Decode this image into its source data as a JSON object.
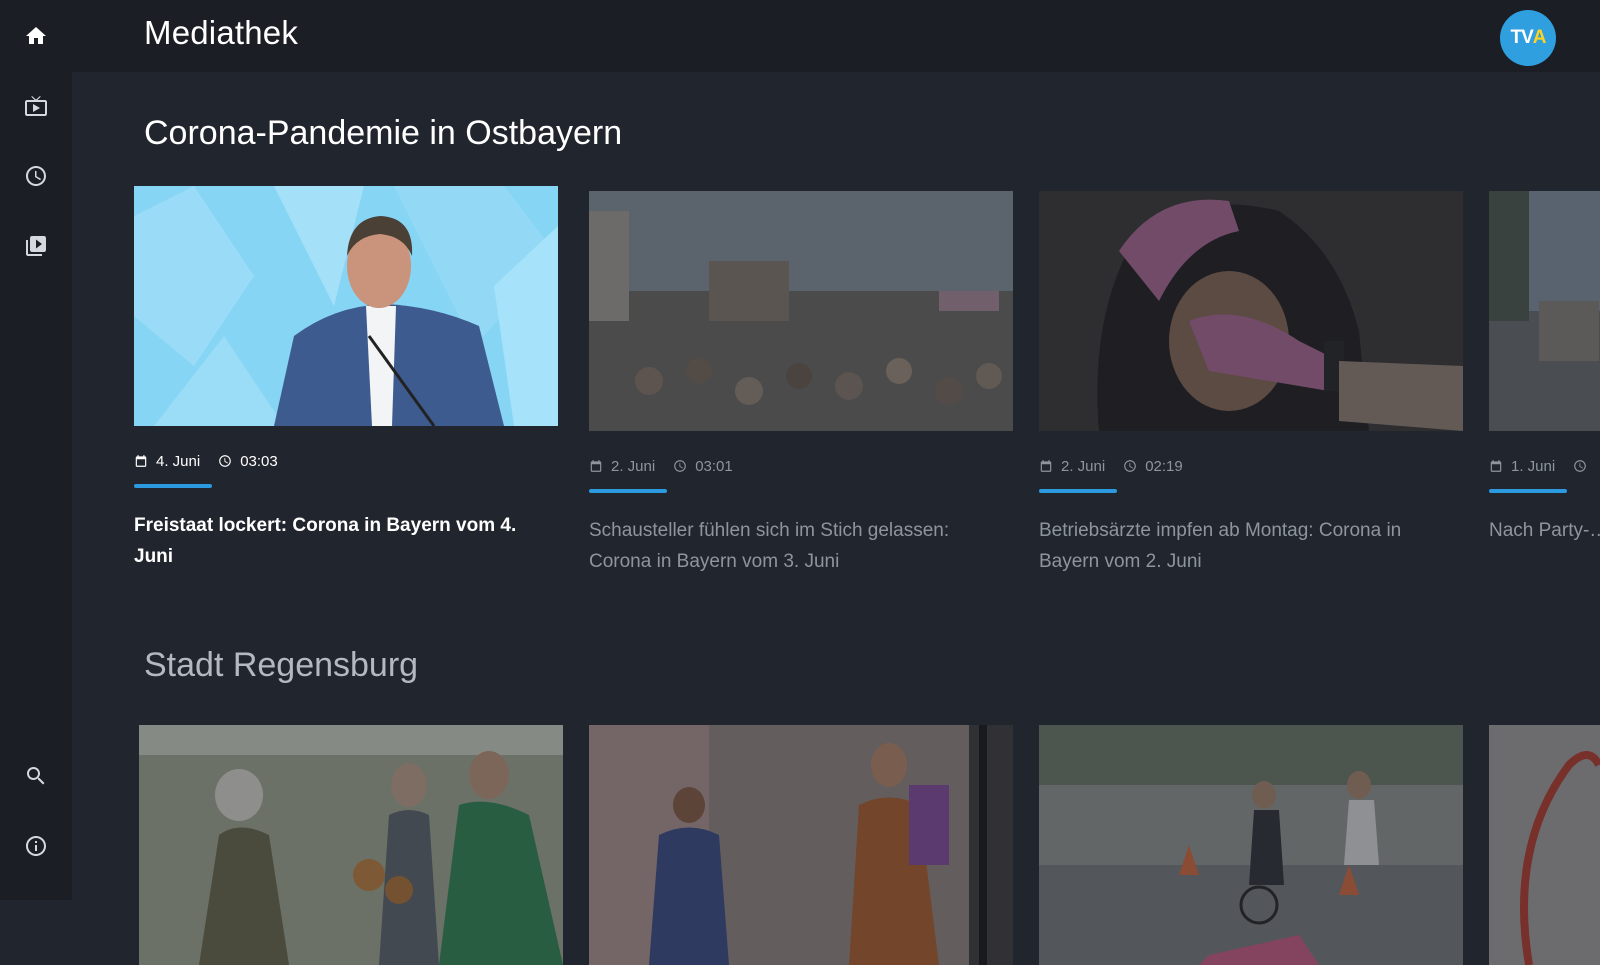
{
  "header": {
    "title": "Mediathek",
    "logo": {
      "text_main": "TV",
      "text_accent": "A"
    }
  },
  "sidebar": {
    "items": [
      {
        "name": "home",
        "icon": "home-icon"
      },
      {
        "name": "live-tv",
        "icon": "tv-icon"
      },
      {
        "name": "recent",
        "icon": "clock-icon"
      },
      {
        "name": "library",
        "icon": "video-library-icon"
      }
    ],
    "bottom_items": [
      {
        "name": "search",
        "icon": "search-icon"
      },
      {
        "name": "info",
        "icon": "info-icon"
      }
    ]
  },
  "sections": [
    {
      "title": "Corona-Pandemie in Ostbayern",
      "cards": [
        {
          "date": "4. Juni",
          "duration": "03:03",
          "title": "Freistaat lockert: Corona in Bayern vom 4. Juni",
          "focused": true
        },
        {
          "date": "2. Juni",
          "duration": "03:01",
          "title": "Schausteller fühlen sich im Stich gelassen: Corona in Bayern vom 3. Juni"
        },
        {
          "date": "2. Juni",
          "duration": "02:19",
          "title": "Betriebsärzte impfen ab Montag: Corona in Bayern vom 2. Juni"
        },
        {
          "date": "1. Juni",
          "duration": "",
          "title": "Nach Party-… ermittelt"
        }
      ]
    },
    {
      "title": "Stadt Regensburg",
      "cards": [
        {},
        {},
        {},
        {}
      ]
    }
  ],
  "colors": {
    "background": "#21252d",
    "bar_background": "#1b1e24",
    "accent": "#2c9ae0",
    "logo_bg": "#2f9fe0",
    "logo_accent": "#ffd321"
  }
}
